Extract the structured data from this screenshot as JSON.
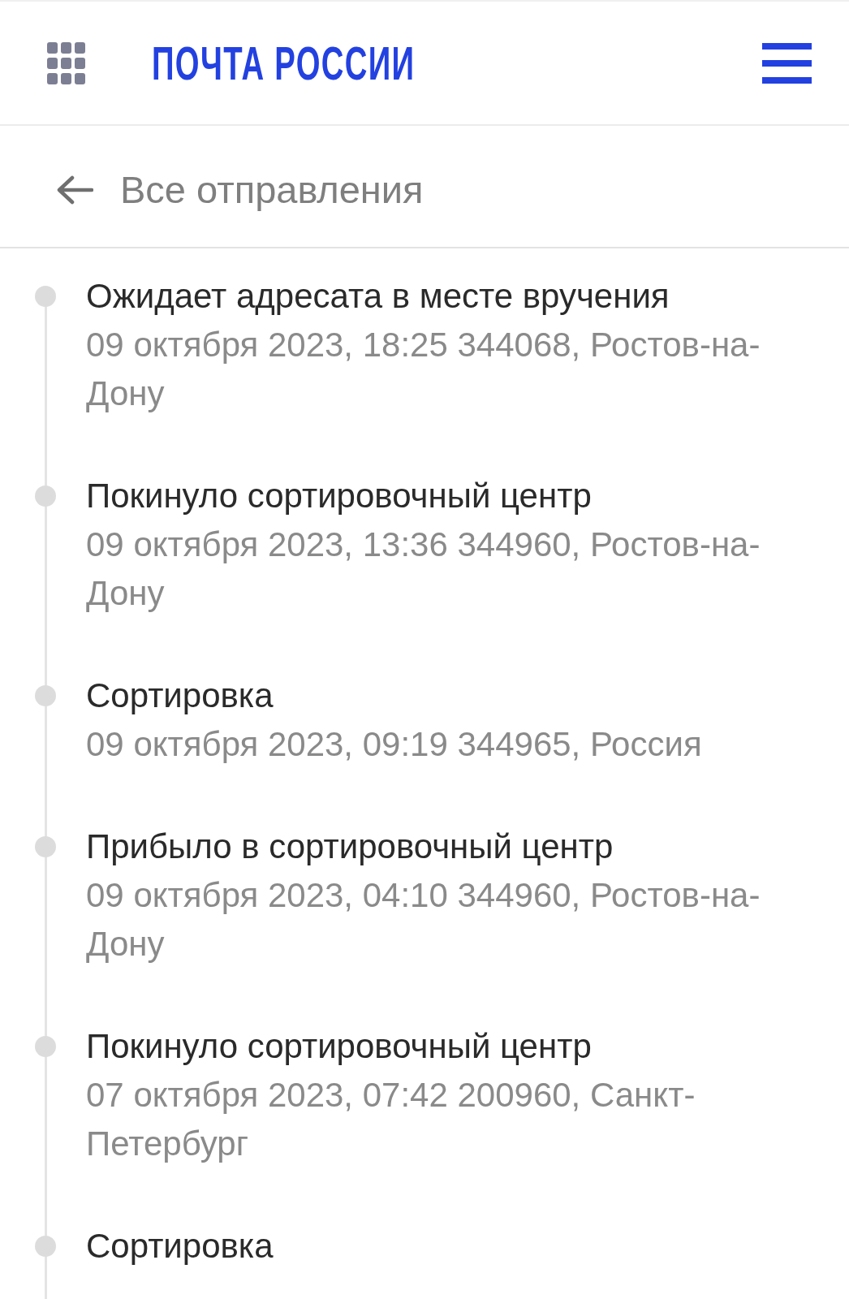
{
  "header": {
    "logo": "ПОЧТА РОССИИ"
  },
  "back_link": {
    "label": "Все отправления"
  },
  "events": [
    {
      "title": "Ожидает адресата в месте вручения",
      "detail": "09 октября 2023, 18:25 344068, Ростов-на-Дону"
    },
    {
      "title": "Покинуло сортировочный центр",
      "detail": "09 октября 2023, 13:36 344960, Ростов-на-Дону"
    },
    {
      "title": "Сортировка",
      "detail": "09 октября 2023, 09:19 344965, Россия"
    },
    {
      "title": "Прибыло в сортировочный центр",
      "detail": "09 октября 2023, 04:10 344960, Ростов-на-Дону"
    },
    {
      "title": "Покинуло сортировочный центр",
      "detail": "07 октября 2023, 07:42 200960, Санкт-Петербург"
    },
    {
      "title": "Сортировка"
    }
  ]
}
